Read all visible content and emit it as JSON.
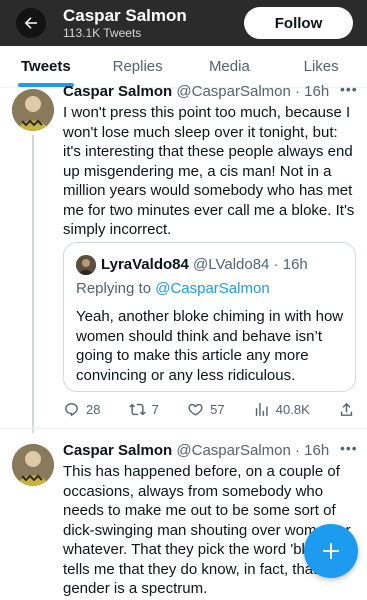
{
  "header": {
    "title": "Caspar Salmon",
    "subtitle": "113.1K Tweets",
    "follow_label": "Follow"
  },
  "tabs": [
    {
      "label": "Tweets",
      "active": true
    },
    {
      "label": "Replies",
      "active": false
    },
    {
      "label": "Media",
      "active": false
    },
    {
      "label": "Likes",
      "active": false
    }
  ],
  "tweets": [
    {
      "name": "Caspar Salmon",
      "handle": "@CasparSalmon",
      "time": "· 16h",
      "text": "I won't press this point too much, because I won't lose much sleep over it tonight, but: it's interesting that these people always end up misgendering me, a cis man! Not in a million years would somebody who has met me for two minutes ever call me a bloke. It's simply incorrect.",
      "quote": {
        "name": "LyraValdo84",
        "handle": "@LValdo84",
        "time": "· 16h",
        "replying_prefix": "Replying to ",
        "replying_to": "@CasparSalmon",
        "text": "Yeah, another bloke chiming in with how women should think and behave isn’t going to make this article any more convincing or any less ridiculous."
      },
      "stats": {
        "replies": "28",
        "retweets": "7",
        "likes": "57",
        "views": "40.8K"
      }
    },
    {
      "name": "Caspar Salmon",
      "handle": "@CasparSalmon",
      "time": "· 16h",
      "text": "This has happened before, on a couple of occasions, always from somebody who needs to make me out to be some sort of dick-swinging man shouting over women or whatever. That they pick the word 'bloke' tells me that they do know, in fact, that gender is a spectrum."
    }
  ],
  "icons": {
    "back": "arrow-left-icon",
    "more": "more-horizontal-icon",
    "reply": "reply-icon",
    "retweet": "retweet-icon",
    "like": "heart-icon",
    "views": "views-chart-icon",
    "share": "share-icon",
    "compose": "plus-icon"
  },
  "colors": {
    "accent": "#1d9bf0",
    "header_bg": "#2b2b2b",
    "muted": "#536471",
    "border": "#cfd9de"
  }
}
